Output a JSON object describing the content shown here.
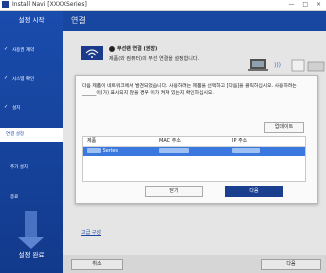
{
  "window": {
    "title": "Install Navi [XXXXSeries]",
    "controls": "— □ ×"
  },
  "sidebar": {
    "header": "설정 시작",
    "steps": [
      {
        "label": "사용권 계약",
        "done": true
      },
      {
        "label": "시스템 확인",
        "done": true
      },
      {
        "label": "설치",
        "done": true
      },
      {
        "label": "연결 설정",
        "active": true
      },
      {
        "label": "추가 설치"
      },
      {
        "label": "종료"
      }
    ],
    "checkmark": "✓",
    "footer": "설정 완료"
  },
  "header": {
    "title": "연결"
  },
  "content": {
    "radio_label": "무선랜 연결 (권장)",
    "radio_sub": "제품(와 컴퓨터)의 무선 연결을 설정합니다.",
    "advanced_link": "고급 구성"
  },
  "dialog": {
    "message": "다음 제품이 네트워크에서 발견되었습니다. 사용하려는 제품을 선택하고 [다음]을 클릭하십시오. 사용하려는 ______이(가) 표시되지 않을 경우 이가 켜져 있는지 확인하십시오.",
    "update_label": "업데이트",
    "columns": [
      "제품",
      "MAC 주소",
      "IP 주소"
    ],
    "rows": [
      {
        "product": "Series",
        "mac": "",
        "ip": ""
      }
    ],
    "close_label": "닫기",
    "next_label": "다음"
  },
  "footer": {
    "cancel_label": "취소",
    "next_label": "다음"
  },
  "colors": {
    "brand_blue": "#1a4cad",
    "selection": "#3a78e0",
    "primary_button": "#1a3f8f"
  }
}
